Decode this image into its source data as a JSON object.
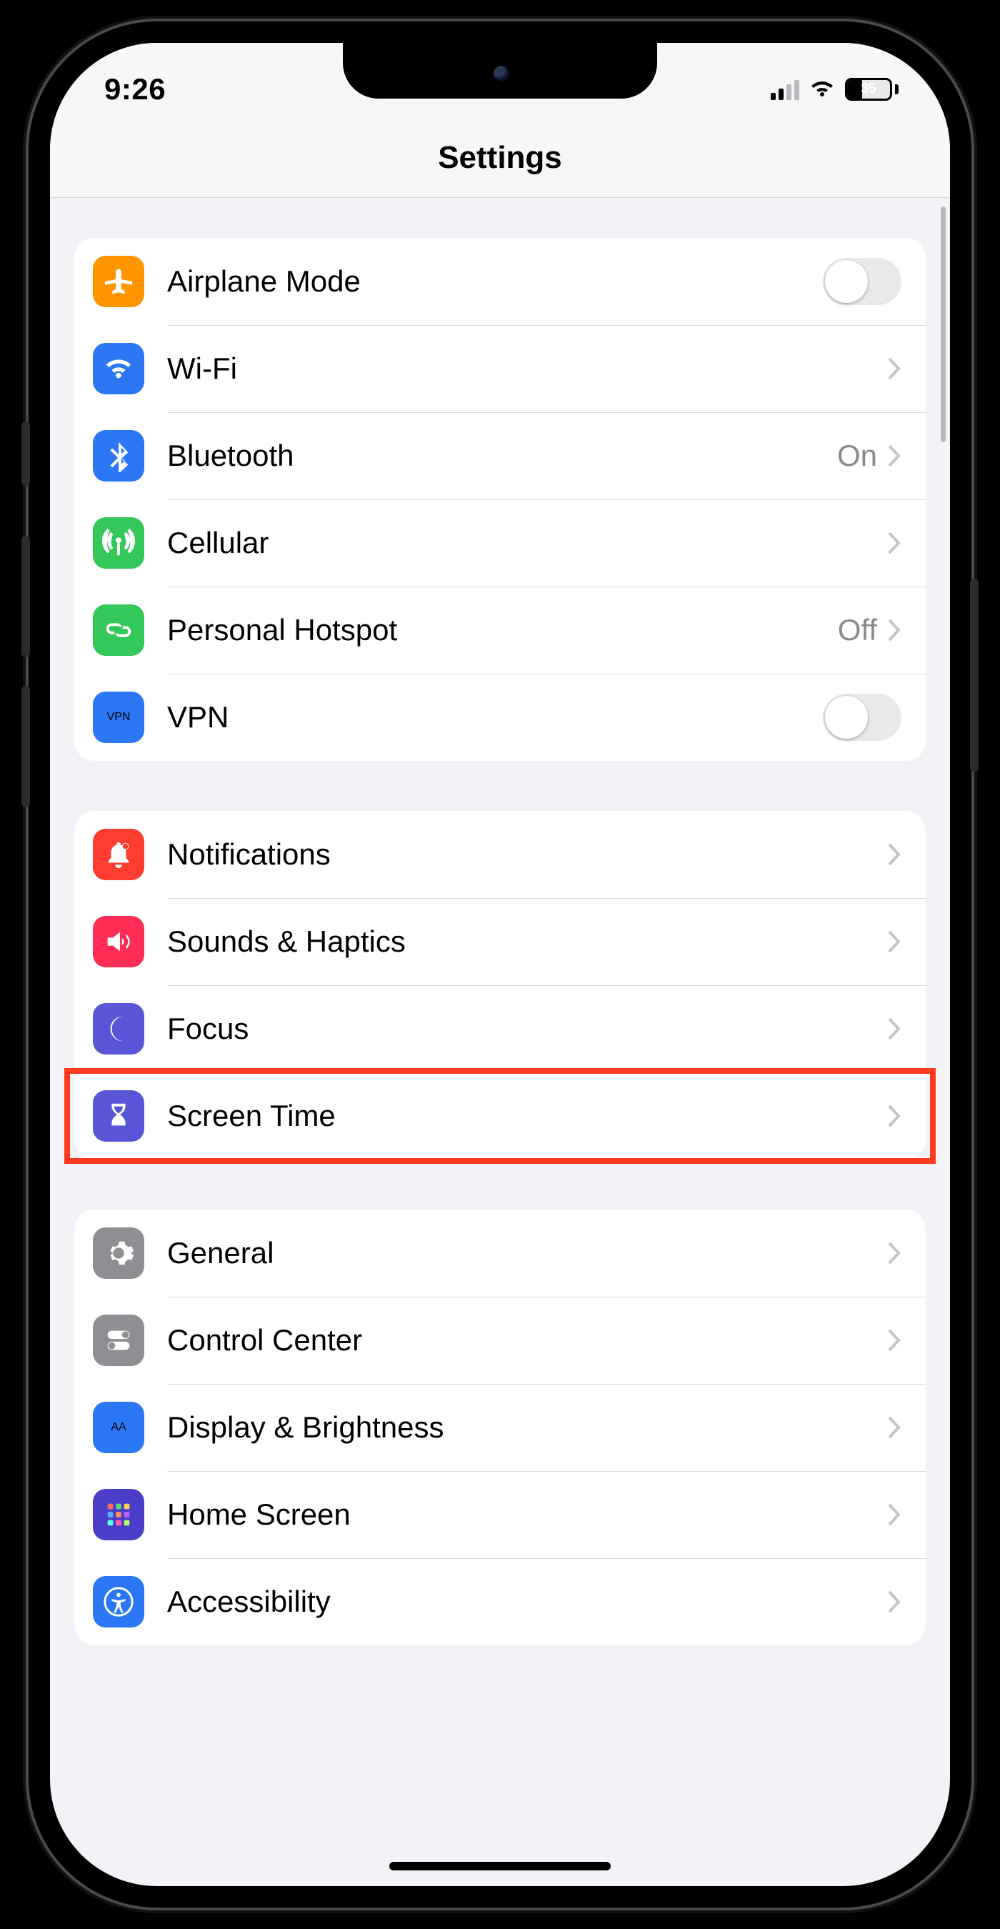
{
  "status": {
    "time": "9:26",
    "battery_pct": "35"
  },
  "nav": {
    "title": "Settings"
  },
  "groups": [
    {
      "rows": [
        {
          "key": "airplane",
          "label": "Airplane Mode",
          "type": "toggle",
          "icon": "airplane",
          "color": "#ff9500"
        },
        {
          "key": "wifi",
          "label": "Wi-Fi",
          "type": "link",
          "detail": "",
          "icon": "wifi",
          "color": "#2b77f6"
        },
        {
          "key": "bluetooth",
          "label": "Bluetooth",
          "type": "link",
          "detail": "On",
          "icon": "bluetooth",
          "color": "#2b77f6"
        },
        {
          "key": "cellular",
          "label": "Cellular",
          "type": "link",
          "detail": "",
          "icon": "cellular",
          "color": "#34c759"
        },
        {
          "key": "hotspot",
          "label": "Personal Hotspot",
          "type": "link",
          "detail": "Off",
          "icon": "hotspot",
          "color": "#34c759"
        },
        {
          "key": "vpn",
          "label": "VPN",
          "type": "toggle",
          "icon": "vpn",
          "color": "#2b77f6"
        }
      ]
    },
    {
      "rows": [
        {
          "key": "notifications",
          "label": "Notifications",
          "type": "link",
          "icon": "bell",
          "color": "#ff3c30"
        },
        {
          "key": "sounds",
          "label": "Sounds & Haptics",
          "type": "link",
          "icon": "speaker",
          "color": "#ff2d55"
        },
        {
          "key": "focus",
          "label": "Focus",
          "type": "link",
          "icon": "moon",
          "color": "#5856d6"
        },
        {
          "key": "screentime",
          "label": "Screen Time",
          "type": "link",
          "icon": "hourglass",
          "color": "#5856d6",
          "highlight": true
        }
      ]
    },
    {
      "rows": [
        {
          "key": "general",
          "label": "General",
          "type": "link",
          "icon": "gear",
          "color": "#8e8e93"
        },
        {
          "key": "controlcenter",
          "label": "Control Center",
          "type": "link",
          "icon": "switches",
          "color": "#8e8e93"
        },
        {
          "key": "display",
          "label": "Display & Brightness",
          "type": "link",
          "icon": "aa",
          "color": "#2b77f6"
        },
        {
          "key": "homescreen",
          "label": "Home Screen",
          "type": "link",
          "icon": "grid",
          "color": "#4a3ec9"
        },
        {
          "key": "accessibility",
          "label": "Accessibility",
          "type": "link",
          "icon": "accessibility",
          "color": "#2b77f6"
        }
      ]
    }
  ]
}
